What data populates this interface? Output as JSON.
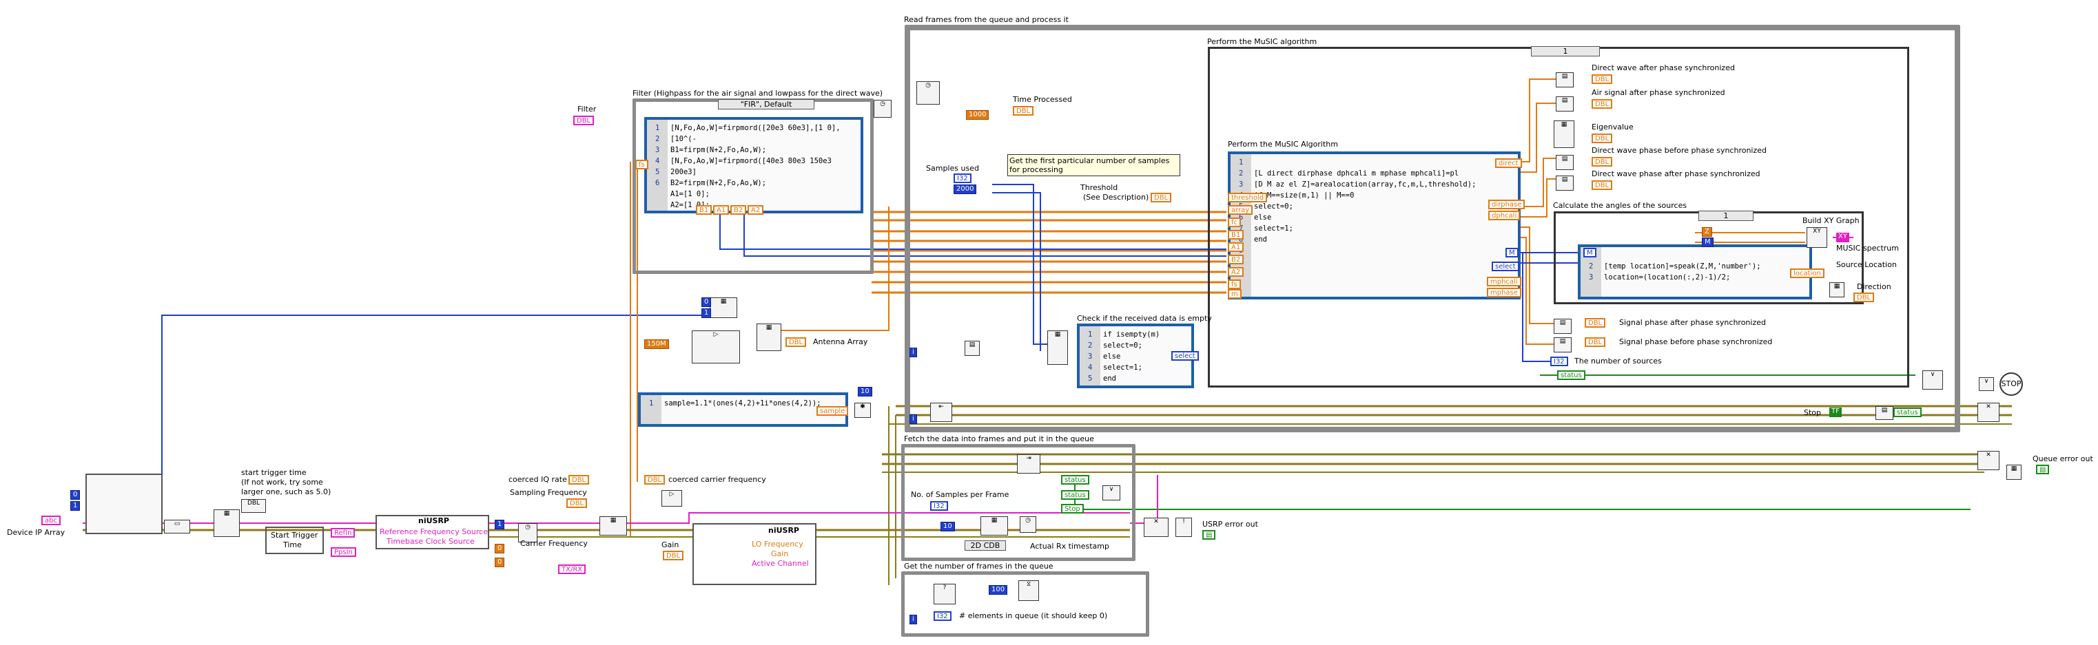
{
  "frames": {
    "read": "Read frames from the queue and process it",
    "music_outer": "Perform the MuSIC algorithm",
    "music_inner": "Perform the MuSIC Algorithm",
    "filter": "Filter (Highpass for the air signal and lowpass for the direct wave)",
    "fetch": "Fetch the data into frames and put it in the queue",
    "get_num": "Get the number of frames in the queue",
    "check_empty": "Check if the received data is empty",
    "angles": "Calculate the angles of the sources"
  },
  "selectors": {
    "fir": "\"FIR\", Default",
    "case1": "1",
    "case2": "1",
    "cdb": "2D CDB"
  },
  "filter_code": [
    "[N,Fo,Ao,W]=firpmord([20e3 60e3],[1 0],[10^(-",
    "B1=firpm(N+2,Fo,Ao,W);",
    "[N,Fo,Ao,W]=firpmord([40e3 80e3 150e3 200e3]",
    "B2=firpm(N+2,Fo,Ao,W);",
    "A1=[1 0];",
    "A2=[1 0];"
  ],
  "music_code": [
    "",
    "[L direct dirphase dphcali m mphase mphcali]=pl",
    "[D M az el Z]=arealocation(array,fc,m,L,threshold);",
    "if M==size(m,1) || M==0",
    "select=0;",
    "else",
    "select=1;",
    "end",
    ""
  ],
  "empty_code": [
    "if isempty(m)",
    "select=0;",
    "else",
    "select=1;",
    "end"
  ],
  "angle_code": [
    "",
    "[temp location]=speak(Z,M,'number');",
    "location=(location(:,2)-1)/2;"
  ],
  "sample_code": [
    "sample=1.1*(ones(4,2)+1i*ones(4,2));"
  ],
  "labels": {
    "filter": "Filter",
    "time_processed": "Time Processed",
    "samples_used": "Samples used",
    "first_samples": "Get the first particular number of samples for processing",
    "threshold": "Threshold",
    "see_desc": "(See Description)",
    "antenna_array": "Antenna Array",
    "device_ip": "Device IP Array",
    "start_trigger_time": "start trigger time",
    "start_note_1": "(If not work, try some",
    "start_note_2": "larger one, such as 5.0)",
    "start_trigger_btn_1": "Start Trigger",
    "start_trigger_btn_2": "Time",
    "coerced_iq": "coerced IQ rate",
    "coerced_carrier": "coerced carrier frequency",
    "sampling_freq": "Sampling Frequency",
    "carrier_freq": "Carrier Frequency",
    "gain": "Gain",
    "no_samples": "No. of Samples per Frame",
    "actual_ts": "Actual Rx timestamp",
    "usrp_err": "USRP error out",
    "queue_err": "Queue error out",
    "stop": "Stop",
    "elements": "# elements in queue (it should keep 0)",
    "direct_sync": "Direct wave after phase synchronized",
    "air_sync": "Air signal after phase synchronized",
    "eigenvalue": "Eigenvalue",
    "direct_before": "Direct wave phase before phase synchronized",
    "direct_after": "Direct wave phase after phase synchronized",
    "build_xy": "Build XY Graph",
    "music_spectrum": "MUSIC spectrum",
    "source_location": "Source Location",
    "direction": "Direction",
    "signal_after": "Signal phase after phase synchronized",
    "signal_before": "Signal phase before phase synchronized",
    "num_sources": "The number of sources",
    "ni_usrp_1": "niUSRP",
    "ni_usrp_2": "niUSRP",
    "ref_freq": "Reference Frequency Source",
    "timebase": "Timebase Clock Source",
    "lo_freq": "LO Frequency",
    "gain_in": "Gain",
    "active_ch": "Active Channel",
    "refin": "RefIn",
    "ppsin": "PpsIn",
    "txrx": "TX/RX",
    "stop_icon": "STOP"
  },
  "constants": {
    "c1000": "1000",
    "c2000": "2000",
    "c150M": "150M",
    "c10": "10",
    "c10b": "10",
    "c100": "100",
    "c0": "0",
    "c1": "1",
    "c0b": "0",
    "c1b": "1"
  },
  "terms": {
    "i32": "I32",
    "dbl": "DBL",
    "threshold": "threshold",
    "array": "array",
    "fc": "fc",
    "m": "m",
    "select": "select",
    "direct": "direct",
    "dirphase": "dirphase",
    "dphcali": "dphcali",
    "mphcali": "mphcali",
    "mphase": "mphase",
    "location": "location",
    "sample": "sample",
    "status": "status",
    "tf": "TF",
    "M": "M",
    "Z": "Z",
    "B1": "B1",
    "A1": "A1",
    "B2": "B2",
    "A2": "A2",
    "fs": "fs"
  },
  "colors": {
    "frame": "#8a8a8a",
    "wire_blue": "#1f3fcc",
    "wire_orange": "#e07a10",
    "wire_pink": "#e020c0",
    "wire_green": "#1a8a1a",
    "wire_olive": "#8c7a1a",
    "script_border": "#1c5faa"
  }
}
